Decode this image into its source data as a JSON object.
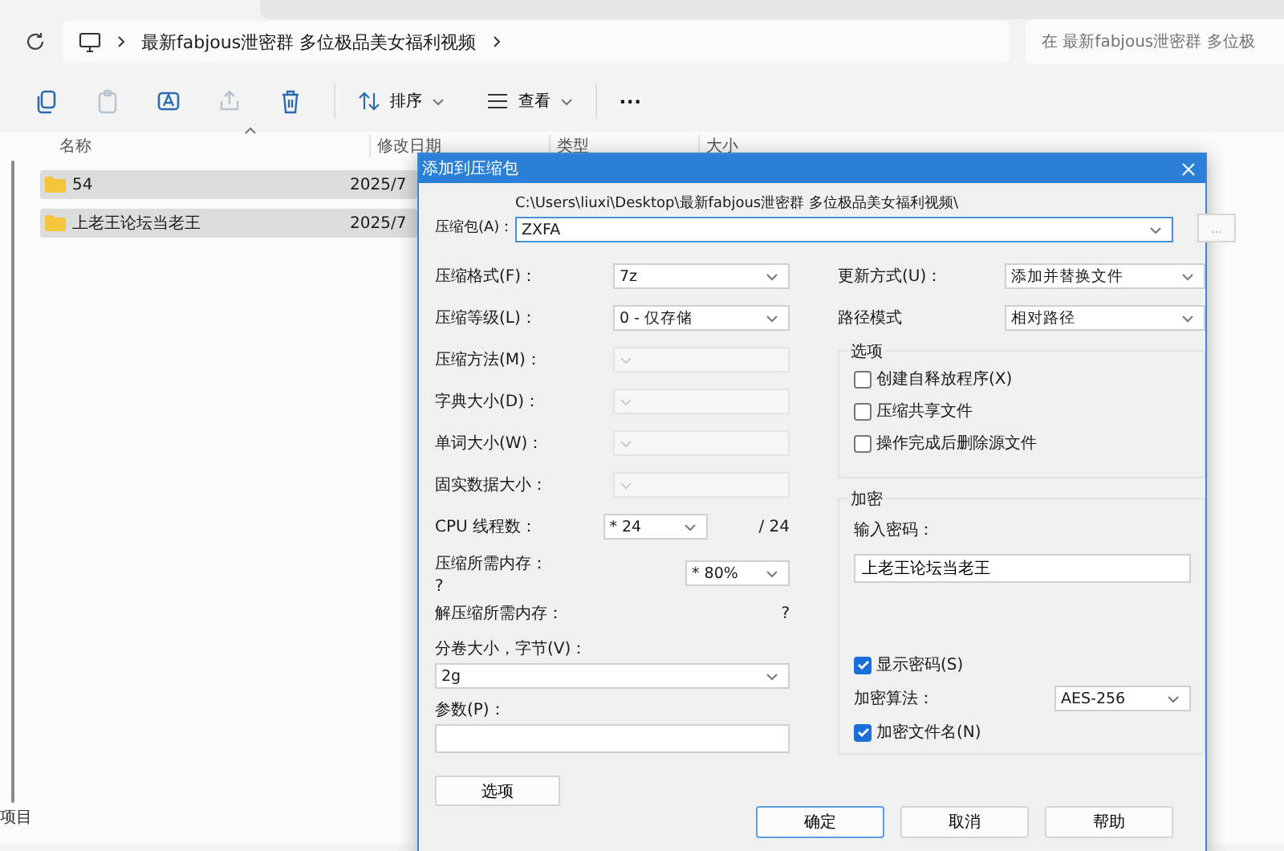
{
  "explorer": {
    "address": {
      "path": "最新fabjous泄密群 多位极品美女福利视频"
    },
    "search": {
      "placeholder": "在 最新fabjous泄密群 多位极"
    },
    "tools": [
      {
        "kind": "copy",
        "disabled": false
      },
      {
        "kind": "paste",
        "disabled": true
      },
      {
        "kind": "rename",
        "disabled": false
      },
      {
        "kind": "share",
        "disabled": true
      },
      {
        "kind": "delete",
        "disabled": false
      }
    ],
    "sort": "排序",
    "view": "查看",
    "more": "···",
    "columns": [
      "名称",
      "修改日期",
      "类型",
      "大小"
    ],
    "files": [
      {
        "name": "54",
        "modified": "2025/7",
        "selected": true
      },
      {
        "name": "上老王论坛当老王",
        "modified": "2025/7",
        "selected": true
      }
    ],
    "status_bar": "项目"
  },
  "dialog": {
    "title": "添加到压缩包",
    "archive": {
      "label": "压缩包(A)：",
      "folder": "C:\\Users\\liuxi\\Desktop\\最新fabjous泄密群 多位极品美女福利视频\\",
      "value": "ZXFA",
      "browse": "..."
    },
    "left": [
      {
        "kind": "select",
        "label": "压缩格式(F)：",
        "value": "7z",
        "disabled": false
      },
      {
        "kind": "select",
        "label": "压缩等级(L)：",
        "value": "0 - 仅存储",
        "disabled": false
      },
      {
        "kind": "select",
        "label": "压缩方法(M)：",
        "disabled": true
      },
      {
        "kind": "select",
        "label": "字典大小(D)：",
        "disabled": true
      },
      {
        "kind": "select",
        "label": "单词大小(W)：",
        "disabled": true
      },
      {
        "kind": "select",
        "label": "固实数据大小：",
        "disabled": true
      },
      {
        "kind": "threads",
        "label": "CPU 线程数：",
        "value": "* 24",
        "max": "/ 24"
      },
      {
        "kind": "memory",
        "label": "压缩所需内存：",
        "reading": "?",
        "value": "* 80%"
      },
      {
        "kind": "reading",
        "label": "解压缩所需内存：",
        "reading": "?"
      },
      {
        "kind": "combo",
        "label": "分卷大小，字节(V)：",
        "value": "2g"
      },
      {
        "kind": "field",
        "label": "参数(P)："
      }
    ],
    "options_button": "选项",
    "update": {
      "label": "更新方式(U)：",
      "value": "添加并替换文件"
    },
    "path_mode": {
      "label": "路径模式",
      "value": "相对路径"
    },
    "options": {
      "title": "选项",
      "checkboxes": [
        {
          "label": "创建自释放程序(X)",
          "checked": false
        },
        {
          "label": "压缩共享文件",
          "checked": false
        },
        {
          "label": "操作完成后删除源文件",
          "checked": false
        }
      ]
    },
    "encryption": {
      "title": "加密",
      "password_label": "输入密码：",
      "password": "上老王论坛当老王",
      "show_password": {
        "label": "显示密码(S)",
        "checked": true
      },
      "method_label": "加密算法：",
      "method": "AES-256",
      "encrypt_names": {
        "label": "加密文件名(N)",
        "checked": true
      }
    },
    "buttons": [
      {
        "label": "确定",
        "default": true
      },
      {
        "label": "取消",
        "default": false
      },
      {
        "label": "帮助",
        "default": false
      }
    ]
  }
}
